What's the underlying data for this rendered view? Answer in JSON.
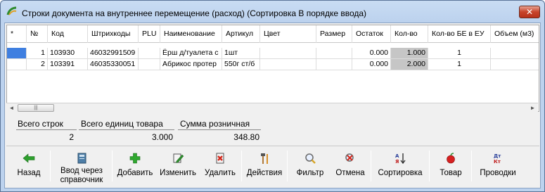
{
  "window": {
    "title": "Строки документа на внутреннее перемещение (расход) (Сортировка В порядке ввода)",
    "close_label": "✕"
  },
  "grid": {
    "columns": [
      "*",
      "№",
      "Код",
      "Штрихкоды",
      "PLU",
      "Наименование",
      "Артикул",
      "Цвет",
      "Размер",
      "Остаток",
      "Кол-во",
      "Кол-во БЕ в ЕУ",
      "Объем (м3)"
    ],
    "rows": [
      {
        "num": "1",
        "code": "103930",
        "barcode": "46032991509",
        "plu": "",
        "name": "Ёрш д/туалета с",
        "article": "1шт",
        "color": "",
        "size": "",
        "rest": "0.000",
        "qty": "1.000",
        "qty_be": "1",
        "volume": ""
      },
      {
        "num": "2",
        "code": "103391",
        "barcode": "46035330051",
        "plu": "",
        "name": "Абрикос протер",
        "article": "550г ст/б",
        "color": "",
        "size": "",
        "rest": "0.000",
        "qty": "2.000",
        "qty_be": "1",
        "volume": ""
      }
    ]
  },
  "scrollbar": {
    "left": "◄",
    "right": "►",
    "thumb": "|||"
  },
  "totals": {
    "rows_label": "Всего строк",
    "rows_value": "2",
    "units_label": "Всего единиц товара",
    "units_value": "3.000",
    "sum_label": "Сумма розничная",
    "sum_value": "348.80"
  },
  "toolbar": {
    "back": "Назад",
    "lookup_line1": "Ввод через",
    "lookup_line2": "справочник",
    "add": "Добавить",
    "edit": "Изменить",
    "delete": "Удалить",
    "actions": "Действия",
    "filter": "Фильтр",
    "cancel": "Отмена",
    "sort": "Сортировка",
    "product": "Товар",
    "postings": "Проводки"
  },
  "colors": {
    "selection": "#2b6fd6",
    "qty_highlight": "#c6c6c6",
    "titlebar": "#bcd2ee",
    "close": "#c7432a"
  }
}
